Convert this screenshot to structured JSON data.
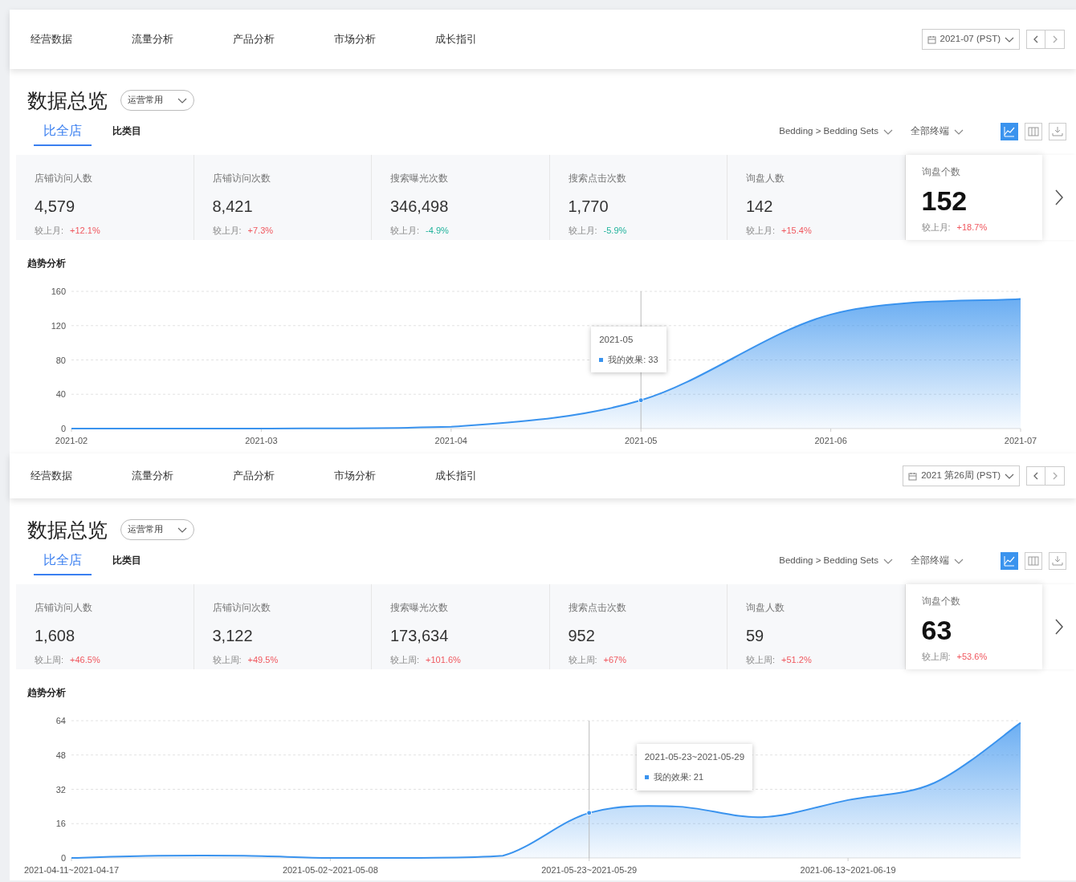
{
  "panels": [
    {
      "nav_tabs": [
        {
          "label": "经营数据"
        },
        {
          "label": "流量分析"
        },
        {
          "label": "产品分析"
        },
        {
          "label": "市场分析"
        },
        {
          "label": "成长指引"
        }
      ],
      "date": "2021-07 (PST)",
      "title": "数据总览",
      "preset": "运营常用",
      "compare_tabs": [
        {
          "label": "比全店",
          "selected": true
        },
        {
          "label": "比类目",
          "selected": false
        }
      ],
      "category": "Bedding > Bedding Sets",
      "device": "全部终端",
      "view_buttons": [
        {
          "kind": "line",
          "selected": true
        },
        {
          "kind": "columns",
          "selected": false
        },
        {
          "kind": "download",
          "selected": false
        }
      ],
      "metrics": [
        {
          "label": "店铺访问人数",
          "value": "4,579",
          "compare_label": "较上月:",
          "change": "+12.1%",
          "color": "#f0575e",
          "selected": false
        },
        {
          "label": "店铺访问次数",
          "value": "8,421",
          "compare_label": "较上月:",
          "change": "+7.3%",
          "color": "#f0575e",
          "selected": false
        },
        {
          "label": "搜索曝光次数",
          "value": "346,498",
          "compare_label": "较上月:",
          "change": "-4.9%",
          "color": "#21b39c",
          "selected": false
        },
        {
          "label": "搜索点击次数",
          "value": "1,770",
          "compare_label": "较上月:",
          "change": "-5.9%",
          "color": "#21b39c",
          "selected": false
        },
        {
          "label": "询盘人数",
          "value": "142",
          "compare_label": "较上月:",
          "change": "+15.4%",
          "color": "#f0575e",
          "selected": false
        },
        {
          "label": "询盘个数",
          "value": "152",
          "compare_label": "较上月:",
          "change": "+18.7%",
          "color": "#f0575e",
          "selected": true
        }
      ],
      "trend": {
        "title": "趋势分析",
        "chart_data": {
          "type": "area",
          "categories": [
            "2021-02",
            "2021-03",
            "2021-04",
            "2021-05",
            "2021-06",
            "2021-07"
          ],
          "ylim": [
            0,
            160
          ],
          "yticks": [
            0,
            40,
            80,
            120,
            160
          ],
          "grid": true,
          "series": [
            {
              "color": "#3a93ee",
              "values": [
                0,
                0,
                2,
                33,
                133,
                151
              ]
            }
          ],
          "ref_lines": [
            {
              "axis": "x",
              "value": "2021-05",
              "color": "#bbbbbb"
            }
          ]
        },
        "tooltip": {
          "title": "2021-05",
          "text": "我的效果: 33"
        }
      }
    },
    {
      "nav_tabs": [
        {
          "label": "经营数据"
        },
        {
          "label": "流量分析"
        },
        {
          "label": "产品分析"
        },
        {
          "label": "市场分析"
        },
        {
          "label": "成长指引"
        }
      ],
      "date": "2021 第26周 (PST)",
      "title": "数据总览",
      "preset": "运营常用",
      "compare_tabs": [
        {
          "label": "比全店",
          "selected": true
        },
        {
          "label": "比类目",
          "selected": false
        }
      ],
      "category": "Bedding > Bedding Sets",
      "device": "全部终端",
      "view_buttons": [
        {
          "kind": "line",
          "selected": true
        },
        {
          "kind": "columns",
          "selected": false
        },
        {
          "kind": "download",
          "selected": false
        }
      ],
      "metrics": [
        {
          "label": "店铺访问人数",
          "value": "1,608",
          "compare_label": "较上周:",
          "change": "+46.5%",
          "color": "#f0575e",
          "selected": false
        },
        {
          "label": "店铺访问次数",
          "value": "3,122",
          "compare_label": "较上周:",
          "change": "+49.5%",
          "color": "#f0575e",
          "selected": false
        },
        {
          "label": "搜索曝光次数",
          "value": "173,634",
          "compare_label": "较上周:",
          "change": "+101.6%",
          "color": "#f0575e",
          "selected": false
        },
        {
          "label": "搜索点击次数",
          "value": "952",
          "compare_label": "较上周:",
          "change": "+67%",
          "color": "#f0575e",
          "selected": false
        },
        {
          "label": "询盘人数",
          "value": "59",
          "compare_label": "较上周:",
          "change": "+51.2%",
          "color": "#f0575e",
          "selected": false
        },
        {
          "label": "询盘个数",
          "value": "63",
          "compare_label": "较上周:",
          "change": "+53.6%",
          "color": "#f0575e",
          "selected": true
        }
      ],
      "trend": {
        "title": "趋势分析",
        "chart_data": {
          "type": "area",
          "categories": [
            "2021-04-11~2021-04-17",
            null,
            null,
            "2021-05-02~2021-05-08",
            null,
            null,
            "2021-05-23~2021-05-29",
            null,
            null,
            "2021-06-13~2021-06-19",
            null,
            null
          ],
          "ylim": [
            0,
            64
          ],
          "yticks": [
            0,
            16,
            32,
            48,
            64
          ],
          "grid": true,
          "series": [
            {
              "color": "#3a93ee",
              "values": [
                0,
                1,
                1,
                0,
                0,
                1,
                21,
                24,
                19,
                27,
                35,
                63
              ]
            }
          ],
          "ref_lines": [
            {
              "axis": "x",
              "value": "2021-05-23~2021-05-29",
              "color": "#bbbbbb"
            }
          ]
        },
        "tooltip": {
          "title": "2021-05-23~2021-05-29",
          "text": "我的效果: 21"
        }
      }
    }
  ]
}
